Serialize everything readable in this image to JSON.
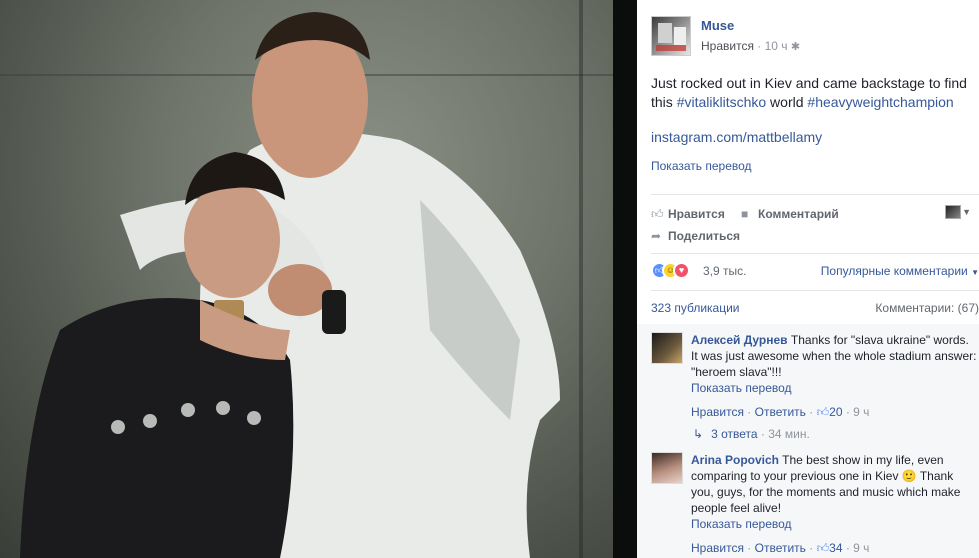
{
  "post": {
    "page_name": "Muse",
    "like_link": "Нравится",
    "separator": " · ",
    "time": "10 ч",
    "privacy_icon": "gear-icon",
    "text_prefix": "Just rocked out in Kiev and came backstage to find this ",
    "hashtag1": "#vitaliklitschko",
    "text_mid": " world ",
    "hashtag2": "#heavyweightchampion",
    "link": "instagram.com/mattbellamy",
    "translate": "Показать перевод"
  },
  "actions": {
    "like": "Нравится",
    "comment": "Комментарий",
    "share": "Поделиться"
  },
  "reactions": {
    "count": "3,9 тыс.",
    "sort": "Популярные комментарии"
  },
  "stats": {
    "shares": "323 публикации",
    "comments": "Комментарии: (67)"
  },
  "comments": [
    {
      "author": "Алексей Дурнев",
      "text": " Thanks for \"slava ukraine\" words. It was just awesome when the whole stadium answer: \"heroem slava\"!!!",
      "translate": "Показать перевод",
      "like": "Нравится",
      "reply": "Ответить",
      "likes": "20",
      "time": "9 ч",
      "replies_label": "3 ответа",
      "replies_time": "34 мин."
    },
    {
      "author": "Arina Popovich",
      "text": " The best show in my life, even comparing to your previous one in Kiev 🙂 Thank you, guys, for the moments and music which make people feel alive!",
      "translate": "Показать перевод",
      "like": "Нравится",
      "reply": "Ответить",
      "likes": "34",
      "time": "9 ч"
    }
  ],
  "colors": {
    "link": "#365899",
    "muted": "#90949c",
    "like_reaction": "#5890ff",
    "love_reaction": "#f25268",
    "haha_reaction": "#fcd22f"
  }
}
